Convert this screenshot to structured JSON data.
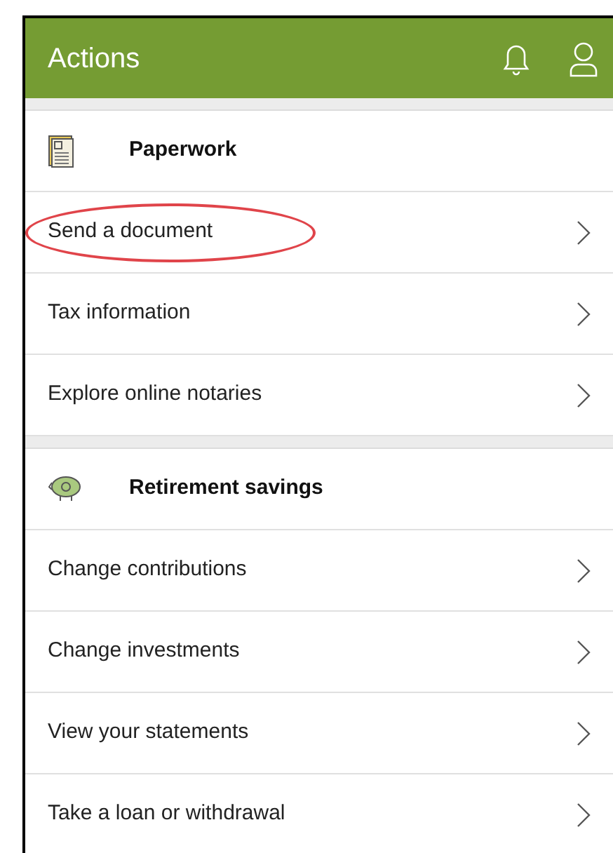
{
  "header": {
    "title": "Actions"
  },
  "sections": [
    {
      "title": "Paperwork",
      "kind": "document",
      "items": [
        {
          "label": "Send a document",
          "circled": true
        },
        {
          "label": "Tax information",
          "circled": false
        },
        {
          "label": "Explore online notaries",
          "circled": false
        }
      ]
    },
    {
      "title": "Retirement savings",
      "kind": "piggy",
      "items": [
        {
          "label": "Change contributions",
          "circled": false
        },
        {
          "label": "Change investments",
          "circled": false
        },
        {
          "label": "View your statements",
          "circled": false
        },
        {
          "label": "Take a loan or withdrawal",
          "circled": false
        }
      ]
    }
  ]
}
